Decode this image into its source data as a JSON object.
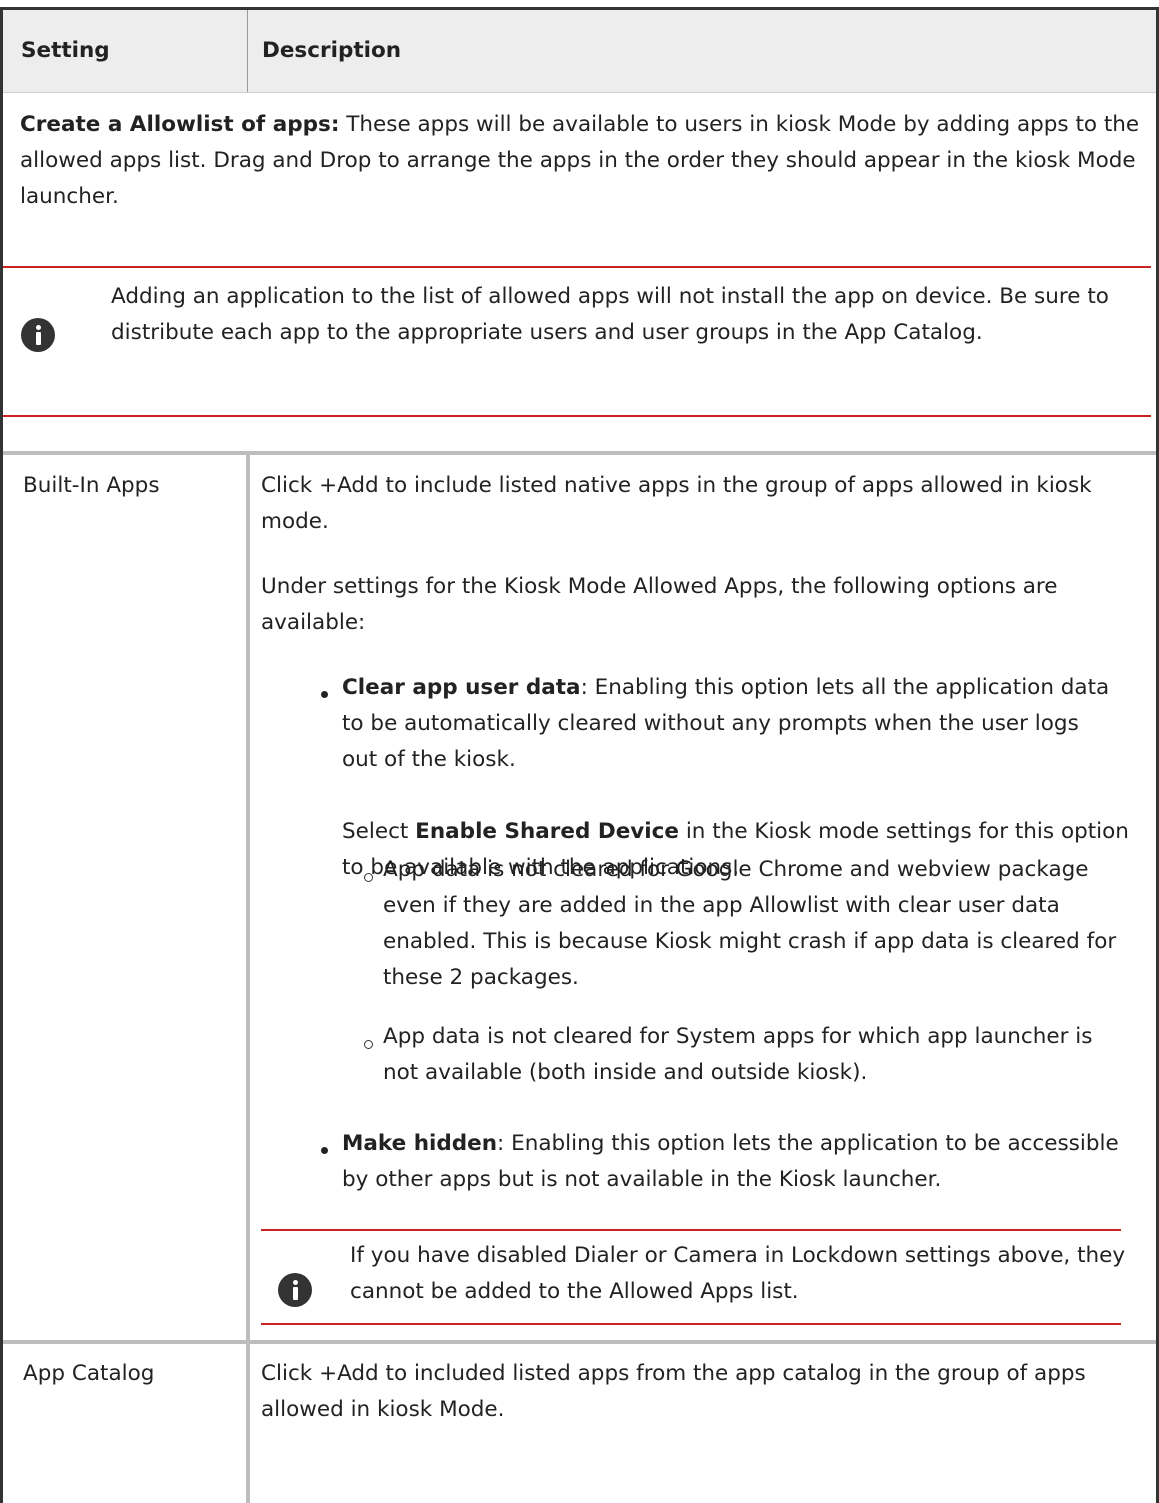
{
  "header": {
    "col_setting": "Setting",
    "col_description": "Description"
  },
  "intro": {
    "bold": "Create a Allowlist of apps:",
    "text": " These apps will be available to users in kiosk Mode by adding apps to the allowed apps list. Drag and Drop to arrange the apps in the order they should appear in the kiosk Mode launcher."
  },
  "intro_note": {
    "icon": "info-icon",
    "text": "Adding an application to the list of allowed apps will not install the app on device. Be sure to distribute each app to the appropriate users and user groups in the App Catalog."
  },
  "rows": [
    {
      "setting": "Built-In Apps",
      "desc_1": "Click +Add to include listed native apps in the group of apps allowed in kiosk mode.",
      "desc_2": "Under settings for the Kiosk Mode Allowed Apps, the following options are available:",
      "bullets": [
        {
          "title": "Clear app user data",
          "text": ": Enabling this option lets all the application data to be automatically cleared without any prompts when the user logs out of the kiosk.",
          "select_prefix": "Select ",
          "select_bold": "Enable Shared Device",
          "select_suffix": " in the Kiosk mode settings for this option to be available with the applications.",
          "subbullets": [
            "App data is not cleared for Google Chrome and webview package even if they are added in the app Allowlist with clear user data enabled. This is because Kiosk might crash if app data is cleared for these 2 packages.",
            "App data is not cleared for System apps for which app launcher is not available (both inside and outside kiosk)."
          ]
        },
        {
          "title": "Make hidden",
          "text": ": Enabling this option lets the application to be accessible by other apps but is not available in the Kiosk launcher."
        }
      ],
      "note": {
        "icon": "info-icon",
        "text": "If you have disabled Dialer or Camera in Lockdown settings above, they cannot be added to the Allowed Apps list."
      }
    },
    {
      "setting": "App Catalog",
      "desc_1": "Click +Add to included listed apps from the app catalog in the group of apps allowed in kiosk Mode."
    }
  ],
  "colors": {
    "note_rule": "#cc2222",
    "header_bg": "#ededed",
    "icon": "#333333"
  }
}
